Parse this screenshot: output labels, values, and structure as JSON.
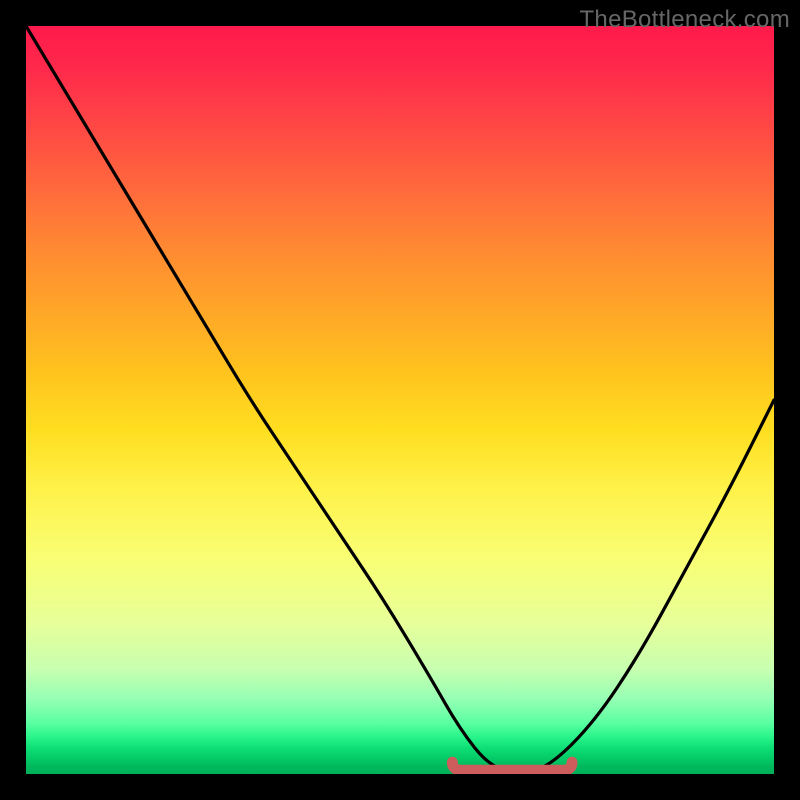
{
  "watermark": "TheBottleneck.com",
  "colors": {
    "background": "#000000",
    "curve": "#000000",
    "marker": "#cd5c5c",
    "text": "#666666"
  },
  "chart_data": {
    "type": "line",
    "title": "",
    "xlabel": "",
    "ylabel": "",
    "xlim": [
      0,
      100
    ],
    "ylim": [
      0,
      100
    ],
    "grid": false,
    "legend": false,
    "annotations": [
      "V-shaped bottleneck curve over vertical red→green gradient; minimum near x≈65"
    ],
    "series": [
      {
        "name": "bottleneck-curve",
        "x": [
          0,
          6,
          12,
          18,
          24,
          30,
          36,
          42,
          48,
          54,
          58,
          62,
          66,
          70,
          76,
          82,
          88,
          94,
          100
        ],
        "y": [
          100,
          90,
          80,
          70,
          60,
          50,
          41,
          32,
          23,
          13,
          6,
          1,
          0,
          1,
          7,
          16,
          27,
          38,
          50
        ]
      }
    ],
    "optimal_range": {
      "xmin": 57,
      "xmax": 73,
      "y": 0.5
    },
    "gradient_stops": [
      {
        "pos": 0,
        "color": "#ff1a4b"
      },
      {
        "pos": 50,
        "color": "#ffde20"
      },
      {
        "pos": 85,
        "color": "#c8ffb0"
      },
      {
        "pos": 100,
        "color": "#00b058"
      }
    ]
  }
}
